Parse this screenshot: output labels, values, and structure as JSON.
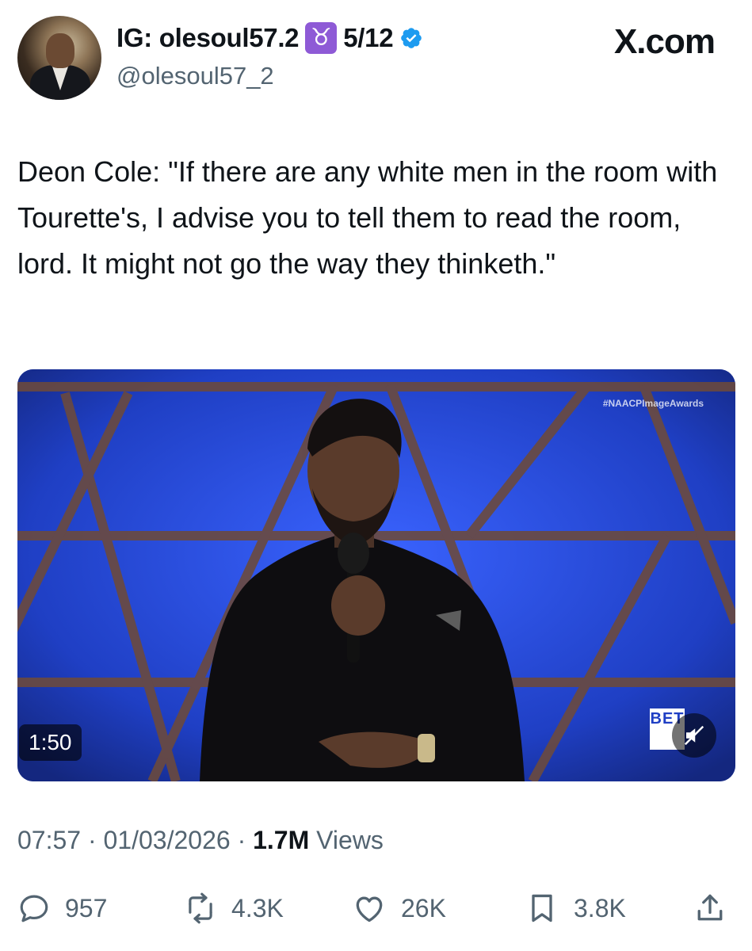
{
  "header": {
    "display_name": "IG: olesoul57.2",
    "zodiac_badge": "♉",
    "name_suffix": "5/12",
    "handle": "@olesoul57_2",
    "site_label": "X.com",
    "verified": true,
    "verified_color": "#1d9bf0",
    "badge_color": "#8e5ad6"
  },
  "tweet": {
    "text": "Deon Cole: \"If there are any white men in the room with Tourette's, I advise you to tell them to read the room, lord. It might not go the way they thinketh.\""
  },
  "media": {
    "type": "video",
    "overlay_hashtag": "#NAACPImageAwards",
    "duration": "1:50",
    "logo_text": "BET",
    "muted": true
  },
  "meta": {
    "time": "07:57",
    "separator": "·",
    "date": "01/03/2026",
    "views_count": "1.7M",
    "views_label": "Views"
  },
  "actions": {
    "replies": "957",
    "reposts": "4.3K",
    "likes": "26K",
    "bookmarks": "3.8K",
    "icons": [
      "reply-icon",
      "repost-icon",
      "like-icon",
      "bookmark-icon",
      "share-icon"
    ],
    "icon_color": "#536471"
  }
}
